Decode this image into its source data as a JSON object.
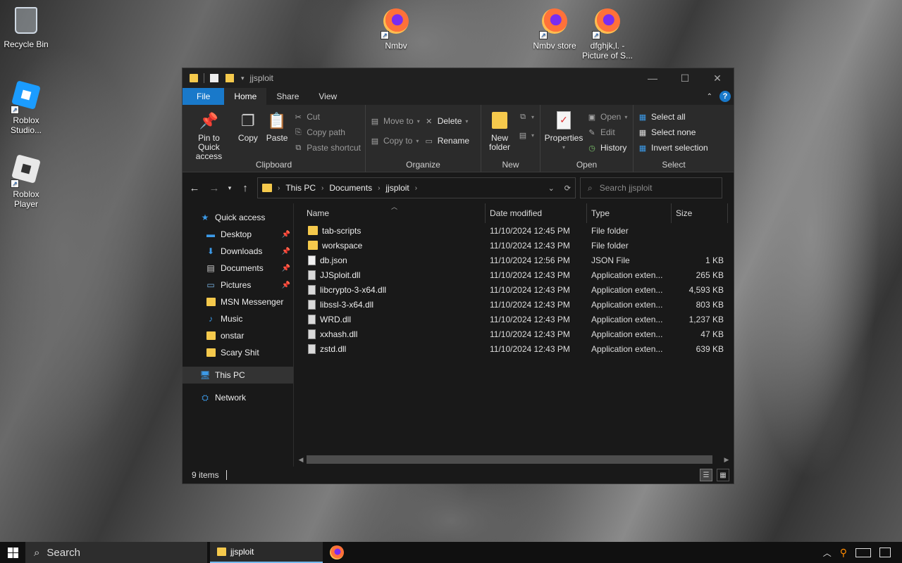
{
  "desktop": {
    "icons": [
      {
        "label": "Recycle Bin",
        "icon": "recycle-bin-icon"
      },
      {
        "label": "Roblox Studio...",
        "icon": "roblox-studio-icon"
      },
      {
        "label": "Roblox Player",
        "icon": "roblox-player-icon"
      },
      {
        "label": "Nmbv",
        "icon": "firefox-icon"
      },
      {
        "label": "Nmbv store",
        "icon": "firefox-icon"
      },
      {
        "label": "dfghjk,l. - Picture of S...",
        "icon": "firefox-icon"
      }
    ]
  },
  "window": {
    "title": "jjsploit",
    "tabs": [
      "File",
      "Home",
      "Share",
      "View"
    ],
    "ribbon": {
      "clipboard": {
        "label": "Clipboard",
        "pin": "Pin to Quick access",
        "copy": "Copy",
        "paste": "Paste",
        "cut": "Cut",
        "copy_path": "Copy path",
        "paste_shortcut": "Paste shortcut"
      },
      "organize": {
        "label": "Organize",
        "move_to": "Move to",
        "copy_to": "Copy to",
        "delete": "Delete",
        "rename": "Rename"
      },
      "new": {
        "label": "New",
        "new_folder": "New folder"
      },
      "open": {
        "label": "Open",
        "properties": "Properties",
        "open": "Open",
        "edit": "Edit",
        "history": "History"
      },
      "select": {
        "label": "Select",
        "select_all": "Select all",
        "select_none": "Select none",
        "invert": "Invert selection"
      }
    },
    "address": {
      "crumbs": [
        "This PC",
        "Documents",
        "jjsploit"
      ],
      "search_placeholder": "Search jjsploit"
    },
    "nav": {
      "quick_access": "Quick access",
      "pinned": [
        "Desktop",
        "Downloads",
        "Documents",
        "Pictures"
      ],
      "folders": [
        "MSN Messenger",
        "Music",
        "onstar",
        "Scary Shit"
      ],
      "this_pc": "This PC",
      "network": "Network"
    },
    "columns": {
      "name": "Name",
      "date": "Date modified",
      "type": "Type",
      "size": "Size"
    },
    "files": [
      {
        "name": "tab-scripts",
        "date": "11/10/2024 12:45 PM",
        "type": "File folder",
        "size": "",
        "kind": "folder"
      },
      {
        "name": "workspace",
        "date": "11/10/2024 12:43 PM",
        "type": "File folder",
        "size": "",
        "kind": "folder"
      },
      {
        "name": "db.json",
        "date": "11/10/2024 12:56 PM",
        "type": "JSON File",
        "size": "1 KB",
        "kind": "file"
      },
      {
        "name": "JJSploit.dll",
        "date": "11/10/2024 12:43 PM",
        "type": "Application exten...",
        "size": "265 KB",
        "kind": "dll"
      },
      {
        "name": "libcrypto-3-x64.dll",
        "date": "11/10/2024 12:43 PM",
        "type": "Application exten...",
        "size": "4,593 KB",
        "kind": "dll"
      },
      {
        "name": "libssl-3-x64.dll",
        "date": "11/10/2024 12:43 PM",
        "type": "Application exten...",
        "size": "803 KB",
        "kind": "dll"
      },
      {
        "name": "WRD.dll",
        "date": "11/10/2024 12:43 PM",
        "type": "Application exten...",
        "size": "1,237 KB",
        "kind": "dll"
      },
      {
        "name": "xxhash.dll",
        "date": "11/10/2024 12:43 PM",
        "type": "Application exten...",
        "size": "47 KB",
        "kind": "dll"
      },
      {
        "name": "zstd.dll",
        "date": "11/10/2024 12:43 PM",
        "type": "Application exten...",
        "size": "639 KB",
        "kind": "dll"
      }
    ],
    "status": "9 items"
  },
  "taskbar": {
    "search": "Search",
    "active_app": "jjsploit"
  },
  "colors": {
    "accent": "#1979ca",
    "folder": "#f5c94c",
    "window_bg": "#191919",
    "ribbon_bg": "#2b2b2b"
  }
}
